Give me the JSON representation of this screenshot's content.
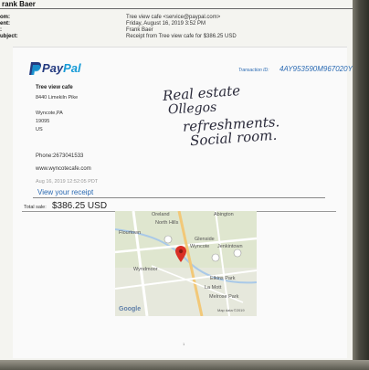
{
  "email": {
    "sender_name": "rank Baer",
    "labels": [
      "om:",
      "ent:",
      ":",
      "ubject:"
    ],
    "from": "Tree view cafe <service@paypal.com>",
    "sent": "Friday, August 16, 2019 3:52 PM",
    "to": "Frank Baer",
    "subject": "Receipt from Tree view cafe for $386.25 USD"
  },
  "receipt": {
    "brand_left": "Pay",
    "brand_right": "Pal",
    "transaction_label": "Transaction ID:",
    "transaction_id": "4AY953590M967020Y",
    "merchant": "Tree view cafe",
    "street": "8440 Limekiln Pike",
    "city": "Wyncote,PA",
    "zip": "19095",
    "country": "US",
    "phone": "Phone:2673041533",
    "website": "www.wyncotecafe.com",
    "timestamp": "Aug 16, 2019 12:52:05 PDT",
    "view_link": "View your receipt",
    "total_label": "Total sale:",
    "total_value": "$386.25 USD"
  },
  "handwriting": [
    "Real estate",
    "Ollegos",
    "refreshments.",
    "Social room."
  ],
  "map": {
    "labels": {
      "oreland": "Oreland",
      "abington": "Abington",
      "north_hills": "North Hills",
      "flourtown": "Flourtown",
      "glenside": "Glenside",
      "wyncote": "Wyncote",
      "jenkintown": "Jenkintown",
      "wyndmoor": "Wyndmoor",
      "elkins_park": "Elkins Park",
      "la_mott": "La Mott",
      "melrose_park": "Melrose Park",
      "google": "Google",
      "map_data": "Map data ©2019"
    },
    "colors": {
      "land": "#dfe6cf",
      "water": "#a9c9e8",
      "road": "#ffffff",
      "highway": "#f2c878",
      "pin": "#d93025"
    }
  },
  "page_number": "1"
}
